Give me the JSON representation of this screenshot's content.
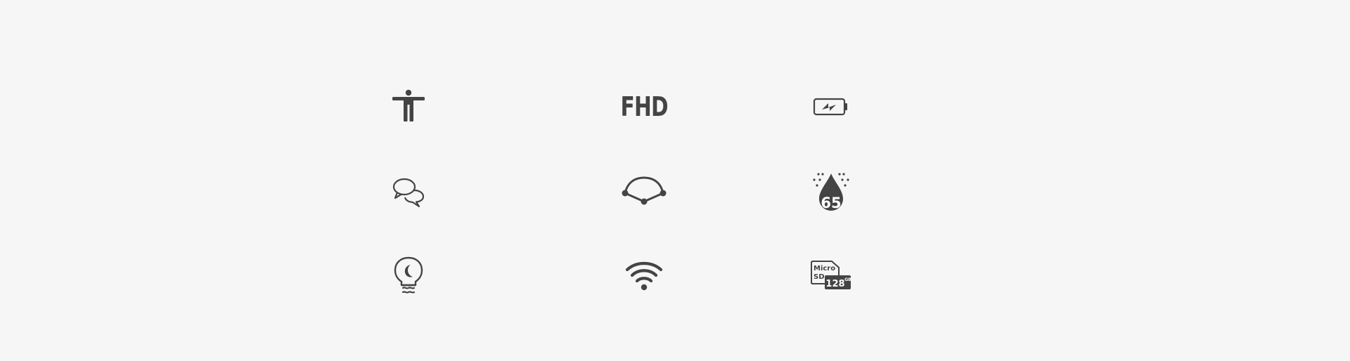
{
  "colors": {
    "background": "#f6f6f6",
    "icon": "#444444",
    "icon_contrast": "#ffffff"
  },
  "icons": [
    {
      "name": "accessibility-icon"
    },
    {
      "name": "fhd-icon",
      "text": "FHD"
    },
    {
      "name": "battery-charging-icon"
    },
    {
      "name": "chat-bubbles-icon"
    },
    {
      "name": "hotspot-network-icon"
    },
    {
      "name": "water-resistance-icon",
      "text": "65"
    },
    {
      "name": "night-light-bulb-icon"
    },
    {
      "name": "wifi-icon"
    },
    {
      "name": "microsd-card-icon",
      "text_line1": "Micro",
      "text_line2": "SD",
      "capacity": "128",
      "unit": "GB"
    }
  ]
}
